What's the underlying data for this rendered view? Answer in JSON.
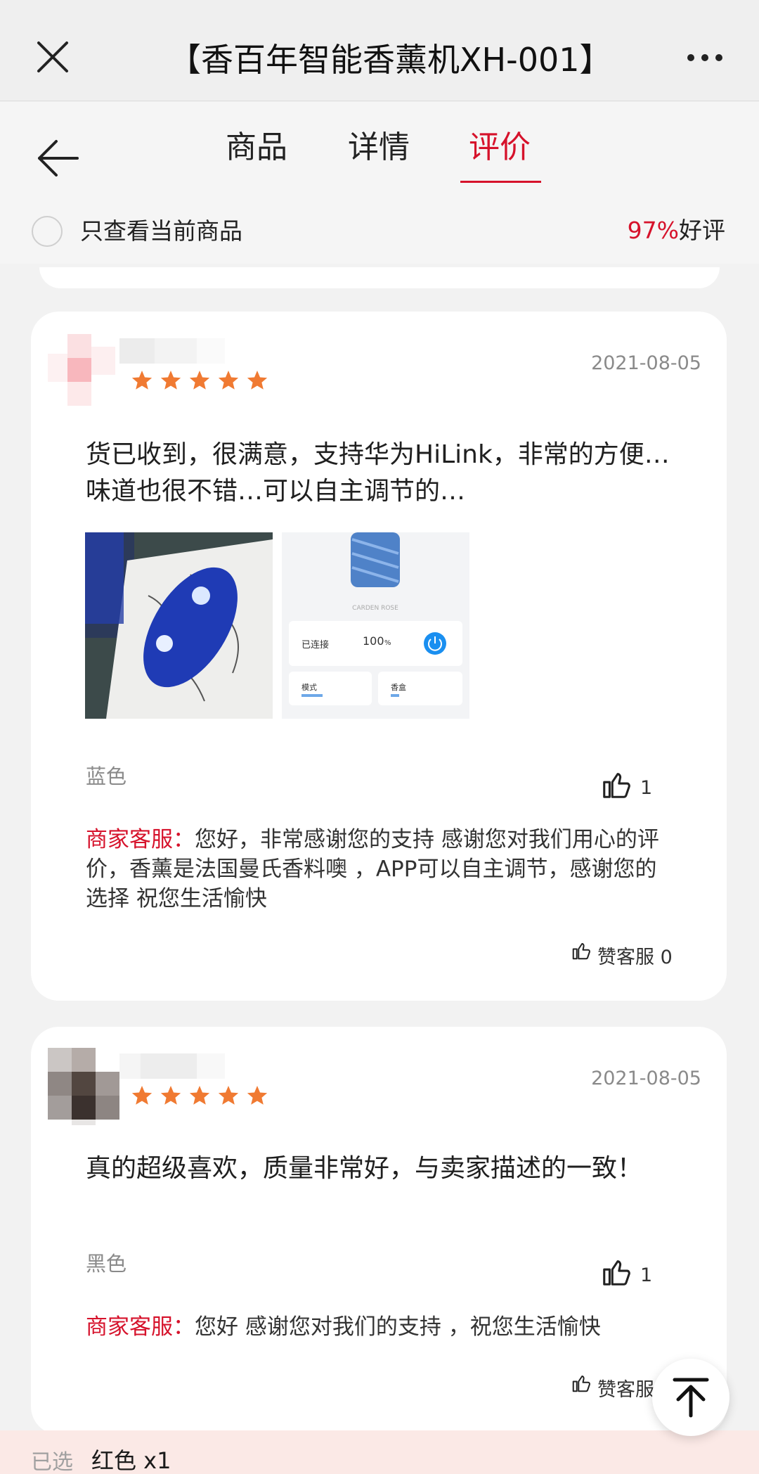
{
  "titlebar": {
    "title": "【香百年智能香薰机XH-001】"
  },
  "tabs": [
    {
      "label": "商品",
      "active": false
    },
    {
      "label": "详情",
      "active": false
    },
    {
      "label": "评价",
      "active": true
    }
  ],
  "filter": {
    "label": "只查看当前商品",
    "rating_pct": "97%",
    "rating_suffix": "好评"
  },
  "reviews": [
    {
      "stars": 5,
      "date": "2021-08-05",
      "text": "货已收到，很满意，支持华为HiLink，非常的方便…味道也很不错…可以自主调节的…",
      "variant": "蓝色",
      "likes": "1",
      "reply_prefix": "商家客服：",
      "reply_text": "您好，非常感谢您的支持 感谢您对我们用心的评价，香薰是法国曼氏香料噢 ，APP可以自主调节，感谢您的选择 祝您生活愉快",
      "thanks": "赞客服 0",
      "app_screen": {
        "status": "已连接",
        "level": "100",
        "level_unit": "%",
        "btn1": "模式",
        "btn2": "香盒"
      }
    },
    {
      "stars": 5,
      "date": "2021-08-05",
      "text": "真的超级喜欢，质量非常好，与卖家描述的一致！",
      "variant": "黑色",
      "likes": "1",
      "reply_prefix": "商家客服：",
      "reply_text": "您好 感谢您对我们的支持 ，祝您生活愉快",
      "thanks": "赞客服 0"
    }
  ],
  "bottom": {
    "selected_label": "已选",
    "selected_value": "红色  x1"
  },
  "colors": {
    "accent": "#d6122b",
    "star": "#f07a32"
  },
  "icons": [
    "close-icon",
    "more-icon",
    "back-arrow-icon",
    "star-icon",
    "thumbs-up-icon",
    "scroll-top-icon"
  ]
}
